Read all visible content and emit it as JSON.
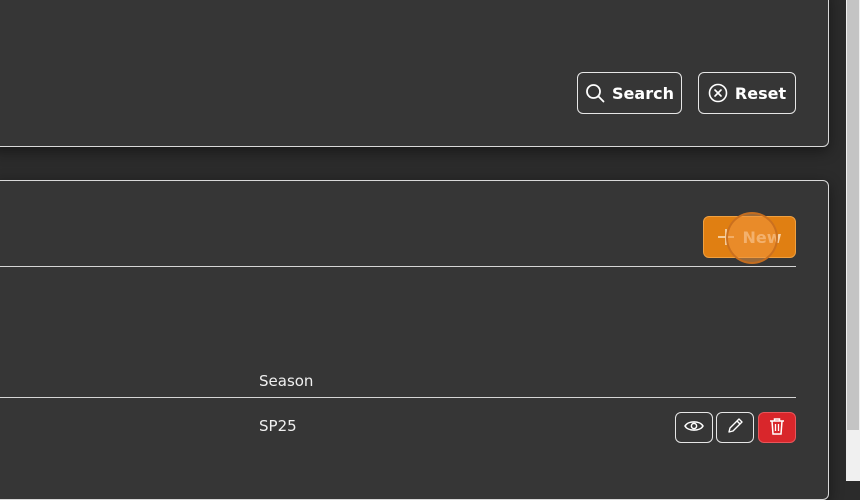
{
  "filter": {
    "search_label": "Search",
    "reset_label": "Reset"
  },
  "table": {
    "new_label": "New",
    "columns": [
      "Season"
    ],
    "rows": [
      {
        "season": "SP25"
      }
    ]
  },
  "icons": {
    "search": "search-icon",
    "reset": "close-circle-icon",
    "new": "plus-icon",
    "view": "eye-icon",
    "edit": "pencil-icon",
    "delete": "trash-icon"
  },
  "colors": {
    "background": "#2b2b2b",
    "card": "#363636",
    "accent": "#e07f12",
    "danger": "#d9262b"
  }
}
